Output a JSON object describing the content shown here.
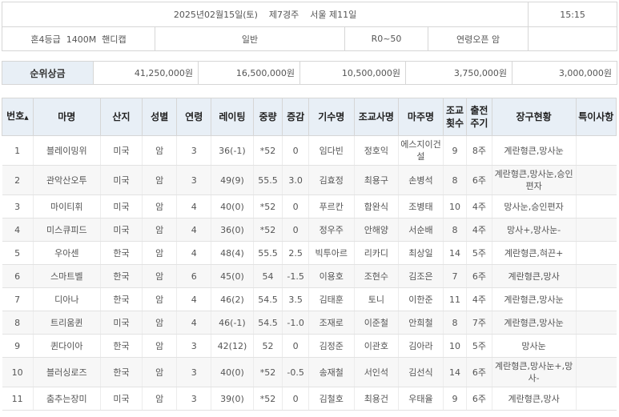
{
  "race_info": {
    "date_line": "2025년02월15일(토)    제7경주    서울 제11일",
    "time": "15:15",
    "grade_distance": "혼4등급  1400M  핸디캡",
    "type": "일반",
    "rating_range": "R0~50",
    "age_sex": "연령오픈 암"
  },
  "prize": {
    "label": "순위상금",
    "values": [
      "41,250,000원",
      "16,500,000원",
      "10,500,000원",
      "3,750,000원",
      "3,000,000원"
    ]
  },
  "table": {
    "headers": {
      "no": "번호",
      "sort_arrow": "▲",
      "horse": "마명",
      "origin": "산지",
      "sex": "성별",
      "age": "연령",
      "rating": "레이팅",
      "weight": "중량",
      "weight_change": "증감",
      "jockey": "기수명",
      "trainer": "조교사명",
      "owner": "마주명",
      "training_count": "조교횟수",
      "start_cycle": "출전주기",
      "equipment": "장구현황",
      "notes": "특이사항"
    },
    "rows": [
      {
        "no": "1",
        "horse": "블레이밍위",
        "origin": "미국",
        "sex": "암",
        "age": "3",
        "rating": "36(-1)",
        "weight": "*52",
        "change": "0",
        "jockey": "임다빈",
        "trainer": "정호익",
        "owner": "에스지이건설",
        "training": "9",
        "cycle": "8주",
        "equipment": "계란형큰,망사눈",
        "notes": ""
      },
      {
        "no": "2",
        "horse": "관악산오투",
        "origin": "미국",
        "sex": "암",
        "age": "3",
        "rating": "49(9)",
        "weight": "55.5",
        "change": "3.0",
        "jockey": "김효정",
        "trainer": "최용구",
        "owner": "손병석",
        "training": "8",
        "cycle": "6주",
        "equipment": "계란형큰,망사눈,승인편자",
        "notes": ""
      },
      {
        "no": "3",
        "horse": "마이티휘",
        "origin": "미국",
        "sex": "암",
        "age": "4",
        "rating": "40(0)",
        "weight": "*52",
        "change": "0",
        "jockey": "푸르칸",
        "trainer": "함완식",
        "owner": "조병태",
        "training": "10",
        "cycle": "4주",
        "equipment": "망사눈,승인편자",
        "notes": ""
      },
      {
        "no": "4",
        "horse": "미스큐피드",
        "origin": "미국",
        "sex": "암",
        "age": "4",
        "rating": "36(0)",
        "weight": "*52",
        "change": "0",
        "jockey": "정우주",
        "trainer": "안해양",
        "owner": "서순배",
        "training": "8",
        "cycle": "4주",
        "equipment": "망사+,망사눈-",
        "notes": ""
      },
      {
        "no": "5",
        "horse": "우아센",
        "origin": "한국",
        "sex": "암",
        "age": "4",
        "rating": "48(4)",
        "weight": "55.5",
        "change": "2.5",
        "jockey": "빅투아르",
        "trainer": "리카디",
        "owner": "최상일",
        "training": "14",
        "cycle": "5주",
        "equipment": "계란형큰,혀끈+",
        "notes": ""
      },
      {
        "no": "6",
        "horse": "스마트벨",
        "origin": "한국",
        "sex": "암",
        "age": "6",
        "rating": "45(0)",
        "weight": "54",
        "change": "-1.5",
        "jockey": "이용호",
        "trainer": "조현수",
        "owner": "김조은",
        "training": "7",
        "cycle": "6주",
        "equipment": "계란형큰,망사",
        "notes": ""
      },
      {
        "no": "7",
        "horse": "디아나",
        "origin": "한국",
        "sex": "암",
        "age": "4",
        "rating": "46(2)",
        "weight": "54.5",
        "change": "3.5",
        "jockey": "김태훈",
        "trainer": "토니",
        "owner": "이한준",
        "training": "11",
        "cycle": "4주",
        "equipment": "계란형큰,망사눈",
        "notes": ""
      },
      {
        "no": "8",
        "horse": "트리움퀸",
        "origin": "미국",
        "sex": "암",
        "age": "4",
        "rating": "46(-1)",
        "weight": "54.5",
        "change": "-1.0",
        "jockey": "조재로",
        "trainer": "이준철",
        "owner": "안희철",
        "training": "8",
        "cycle": "7주",
        "equipment": "계란형큰,망사눈",
        "notes": ""
      },
      {
        "no": "9",
        "horse": "퀸다이아",
        "origin": "한국",
        "sex": "암",
        "age": "3",
        "rating": "42(12)",
        "weight": "52",
        "change": "0",
        "jockey": "김정준",
        "trainer": "이관호",
        "owner": "김아라",
        "training": "10",
        "cycle": "5주",
        "equipment": "망사눈",
        "notes": ""
      },
      {
        "no": "10",
        "horse": "블러싱로즈",
        "origin": "한국",
        "sex": "암",
        "age": "3",
        "rating": "40(0)",
        "weight": "*52",
        "change": "-0.5",
        "jockey": "송재철",
        "trainer": "서인석",
        "owner": "김선식",
        "training": "14",
        "cycle": "6주",
        "equipment": "계란형큰,망사눈+,망사-",
        "notes": ""
      },
      {
        "no": "11",
        "horse": "춤추는장미",
        "origin": "미국",
        "sex": "암",
        "age": "3",
        "rating": "39(0)",
        "weight": "*52",
        "change": "0",
        "jockey": "김철호",
        "trainer": "최용건",
        "owner": "우태율",
        "training": "9",
        "cycle": "6주",
        "equipment": "계란형큰,망사",
        "notes": ""
      }
    ]
  }
}
